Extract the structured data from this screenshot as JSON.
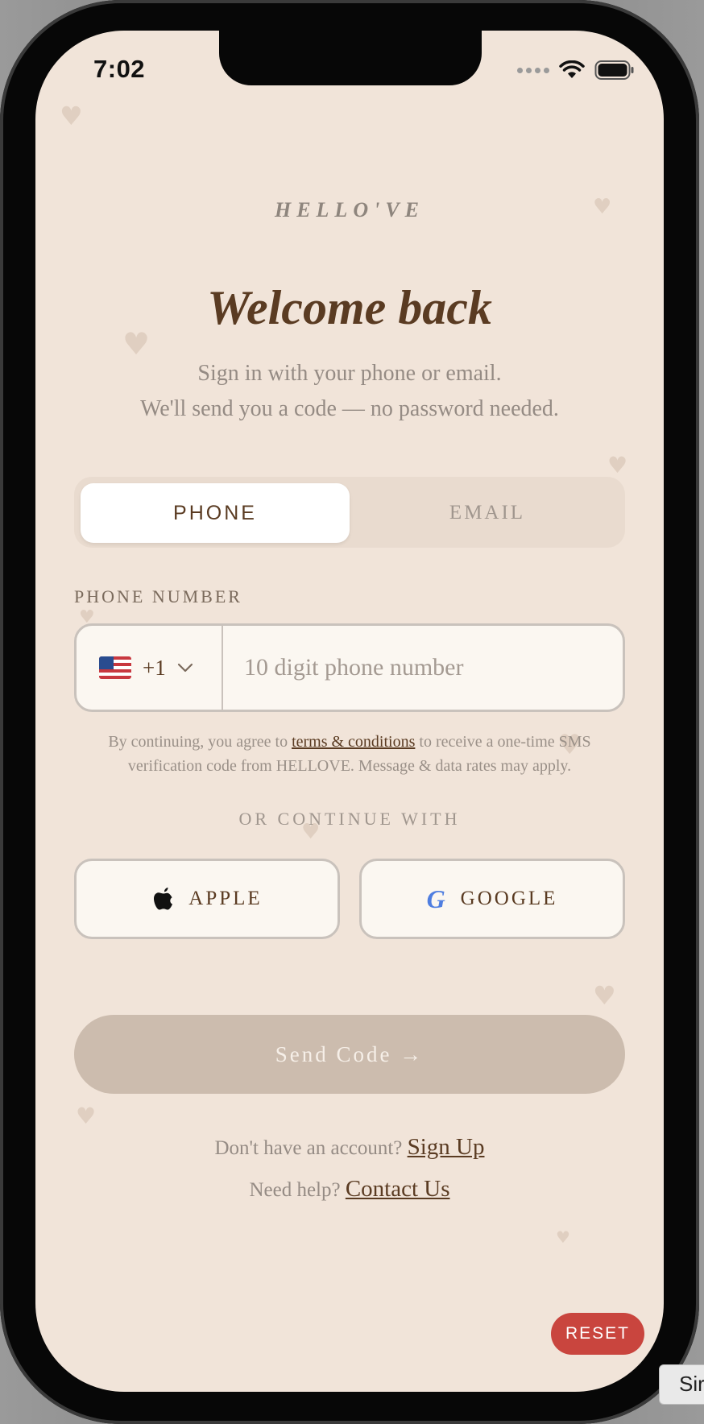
{
  "status_bar": {
    "time": "7:02"
  },
  "brand": "HELLO'VE",
  "title": "Welcome back",
  "subtitle": {
    "line1": "Sign in with your phone or email.",
    "line2": "We'll send you a code — no password needed."
  },
  "tabs": {
    "phone": "PHONE",
    "email": "EMAIL",
    "active": "PHONE"
  },
  "phone_field": {
    "label": "PHONE NUMBER",
    "country_code": "+1",
    "placeholder": "10 digit phone number"
  },
  "terms": {
    "prefix": "By continuing, you agree to",
    "link": "terms & conditions",
    "suffix": "to receive a one-time SMS verification code from HELLOVE. Message & data rates may apply."
  },
  "or_label": "OR CONTINUE WITH",
  "social": {
    "apple": "APPLE",
    "google": "GOOGLE",
    "google_glyph": "G"
  },
  "send_button": "Send Code →",
  "signup": {
    "prompt": "Don't have an account?",
    "link": "Sign Up"
  },
  "help": {
    "prompt": "Need help?",
    "link": "Contact Us"
  },
  "reset_button": "RESET",
  "sim_tab": "Sir",
  "colors": {
    "background": "#f1e4d9",
    "accent_brown": "#5a3b22",
    "send_button": "#ccbcae",
    "reset": "#c9453e",
    "google_blue": "#4f7ee0"
  },
  "icons": [
    "wifi-icon",
    "battery-icon",
    "us-flag-icon",
    "chevron-down-icon",
    "apple-icon",
    "google-icon",
    "heart-icon"
  ]
}
